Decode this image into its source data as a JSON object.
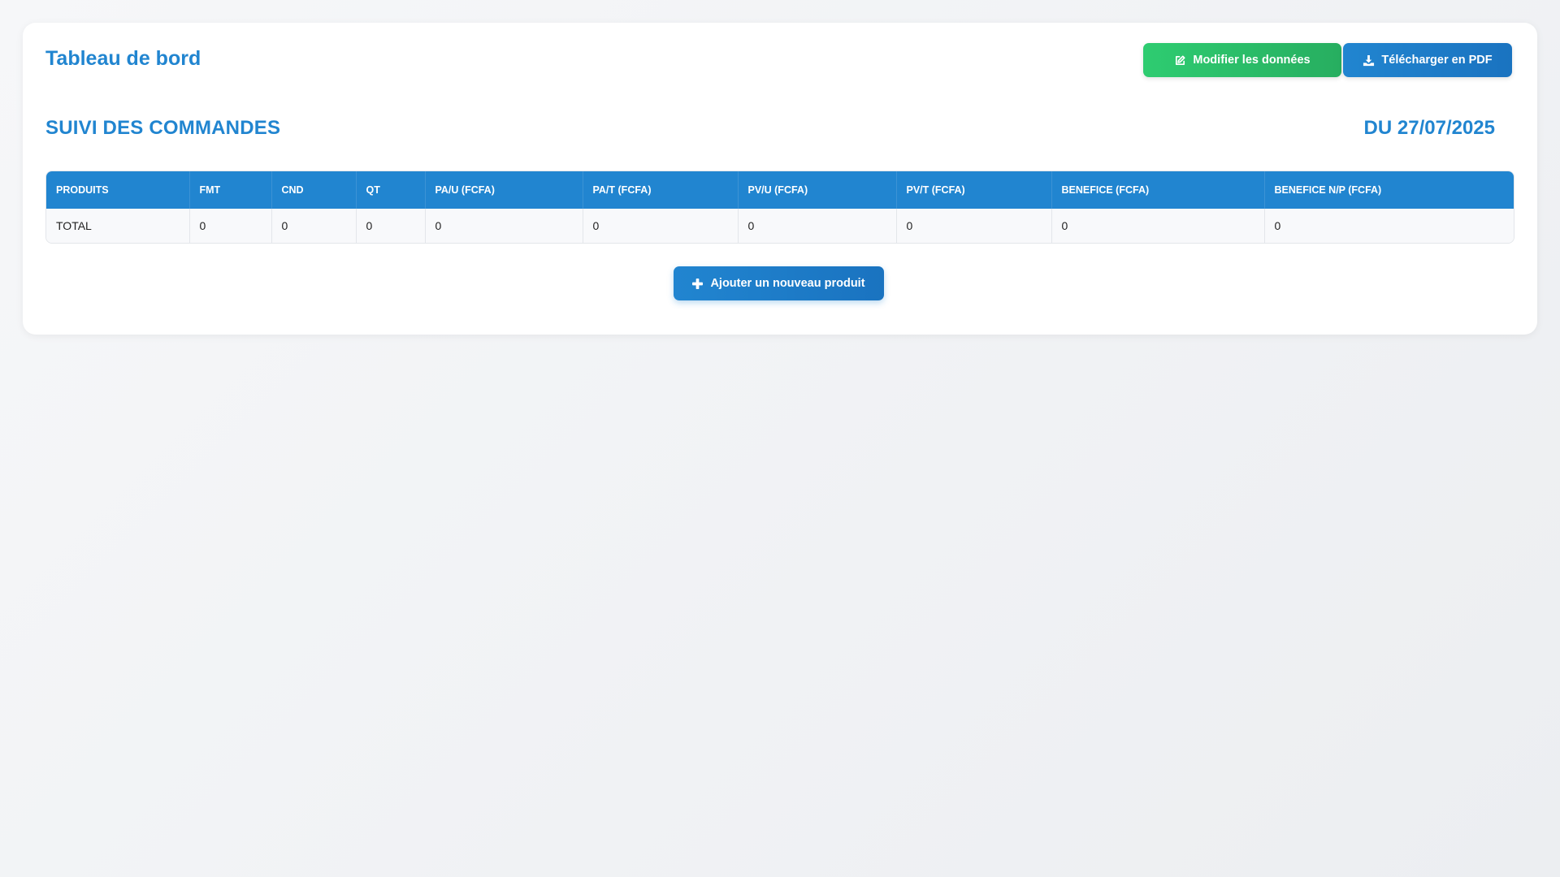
{
  "header": {
    "title": "Tableau de bord",
    "edit_label": "Modifier les données",
    "pdf_label": "Télécharger en PDF"
  },
  "section": {
    "title": "SUIVI DES COMMANDES",
    "date": "DU 27/07/2025"
  },
  "table": {
    "columns": [
      "PRODUITS",
      "FMT",
      "CND",
      "QT",
      "PA/U (FCFA)",
      "PA/T (FCFA)",
      "PV/U (FCFA)",
      "PV/T (FCFA)",
      "BENEFICE (FCFA)",
      "BENEFICE N/P (FCFA)"
    ],
    "rows": [
      [
        "TOTAL",
        "0",
        "0",
        "0",
        "0",
        "0",
        "0",
        "0",
        "0",
        "0"
      ]
    ]
  },
  "actions": {
    "add_label": "Ajouter un nouveau produit"
  },
  "colors": {
    "primary": "#2185d0",
    "success": "#2ecc71"
  },
  "icons": {
    "edit": "edit-icon",
    "download": "download-icon",
    "add": "plus-icon"
  }
}
